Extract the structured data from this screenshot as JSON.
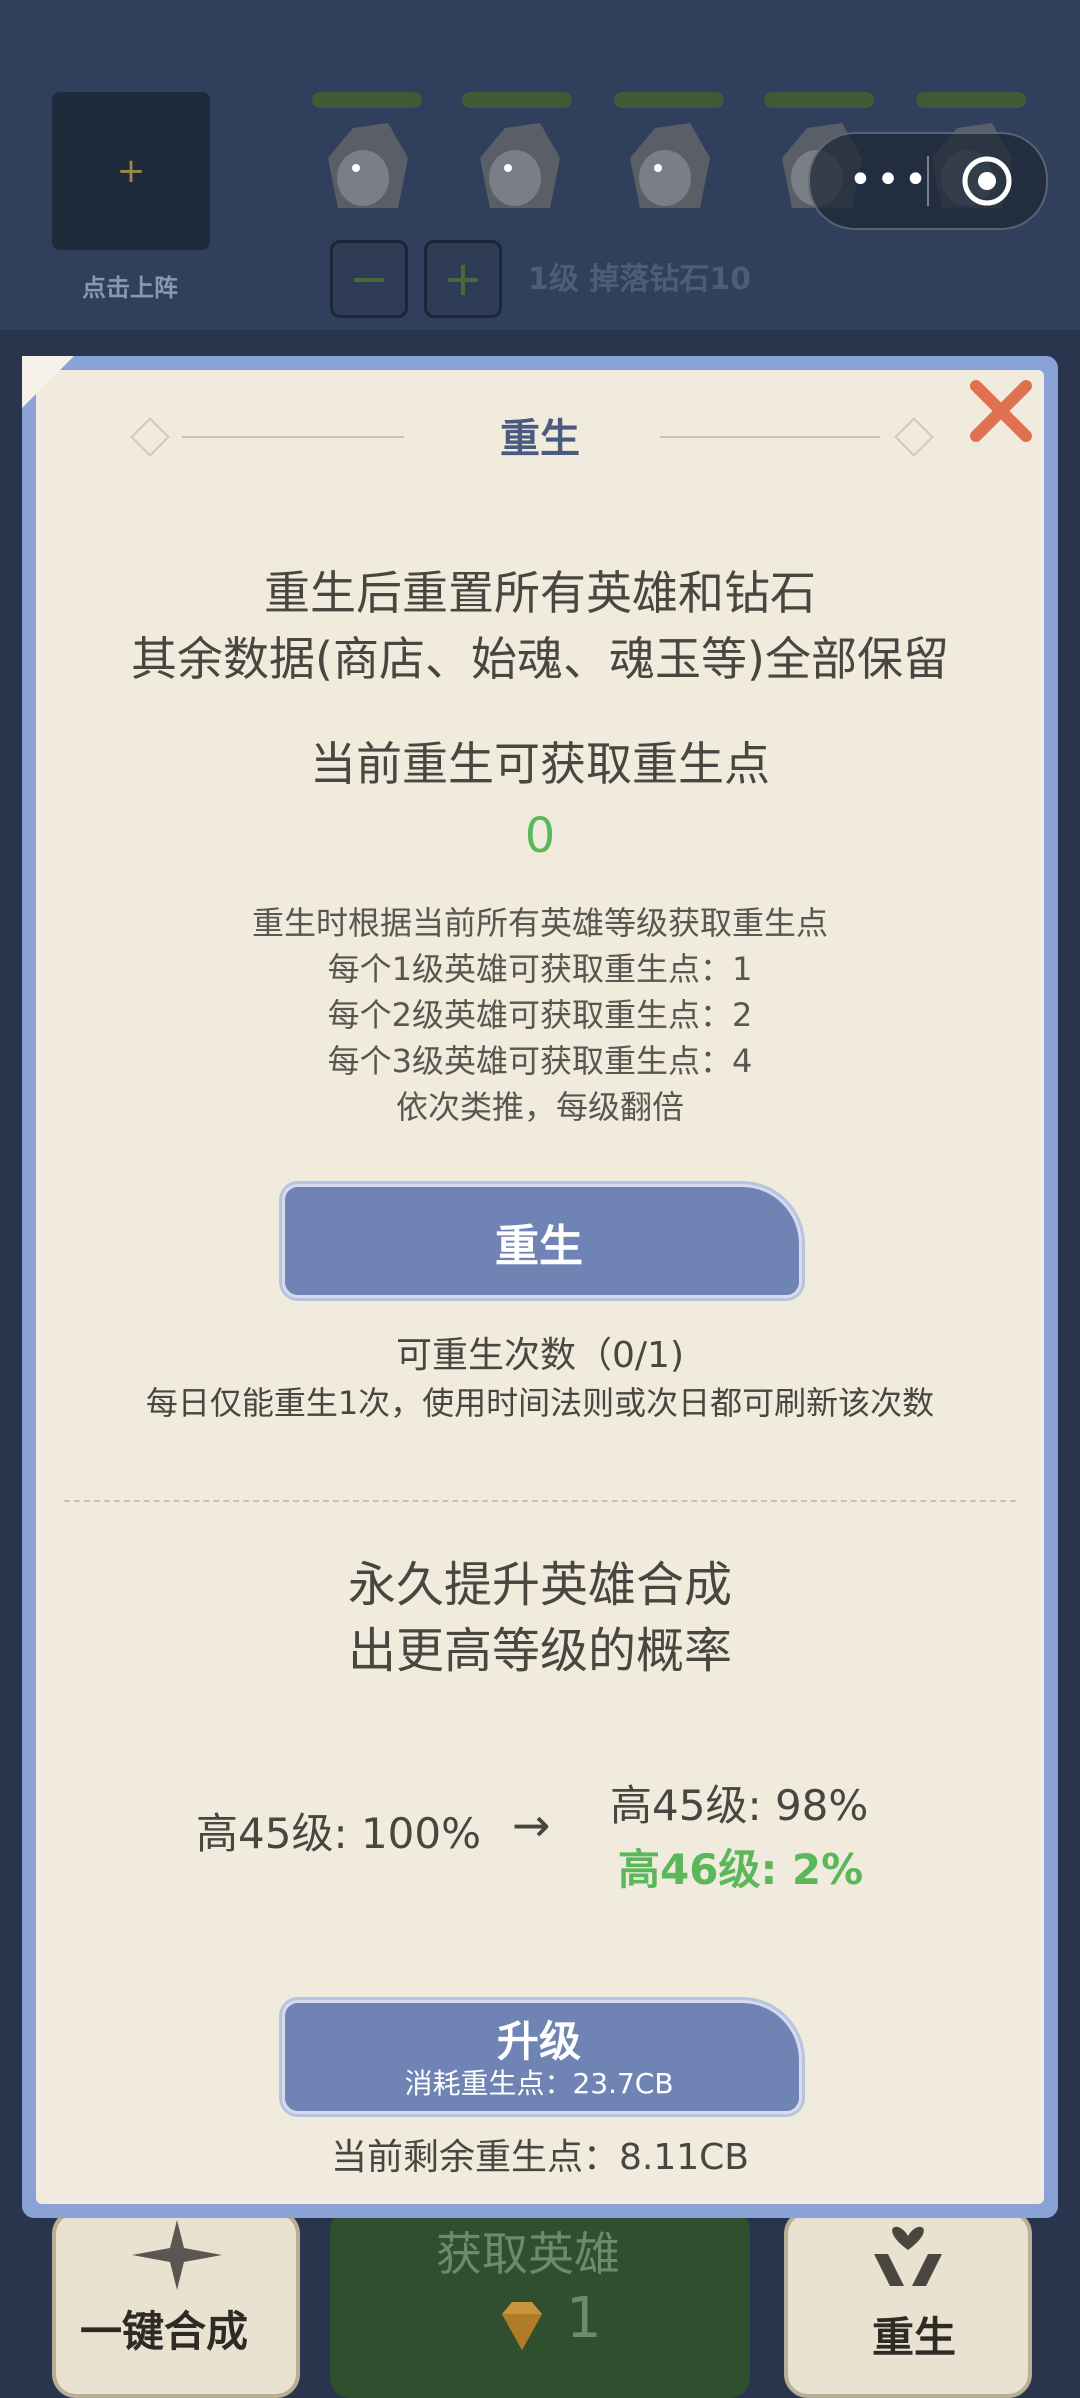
{
  "header": {
    "slot_plus": "+",
    "slot_caption": "点击上阵",
    "minus_label": "−",
    "plus_label": "+",
    "level_info": "1级 掉落钻石10",
    "capsule_dots": "•••"
  },
  "dialog": {
    "title": "重生",
    "description_lines": [
      "重生后重置所有英雄和钻石",
      "其余数据(商店、始魂、魂玉等)全部保留"
    ],
    "current_points_label": "当前重生可获取重生点",
    "current_points_value": "0",
    "rules": [
      "重生时根据当前所有英雄等级获取重生点",
      "每个1级英雄可获取重生点：1",
      "每个2级英雄可获取重生点：2",
      "每个3级英雄可获取重生点：4",
      "依次类推，每级翻倍"
    ],
    "rebirth_button": "重生",
    "rebirth_count": "可重生次数（0/1)",
    "rebirth_note": "每日仅能重生1次，使用时间法则或次日都可刷新该次数",
    "permanent_lines": [
      "永久提升英雄合成",
      "出更高等级的概率"
    ],
    "prob_current": "高45级: 100%",
    "arrow": "→",
    "prob_next_1": "高45级: 98%",
    "prob_next_2": "高46级: 2%",
    "upgrade_button": "升级",
    "upgrade_cost": "消耗重生点：23.7CB",
    "remaining": "当前剩余重生点：8.11CB"
  },
  "bottom_bar": {
    "merge_label": "一键合成",
    "get_hero_label": "获取英雄",
    "get_hero_count": "1",
    "rebirth_label": "重生"
  },
  "colors": {
    "accent_blue": "#6f83b5",
    "green": "#5bb85a",
    "close_orange": "#e0714f",
    "panel": "#f1ebde"
  }
}
